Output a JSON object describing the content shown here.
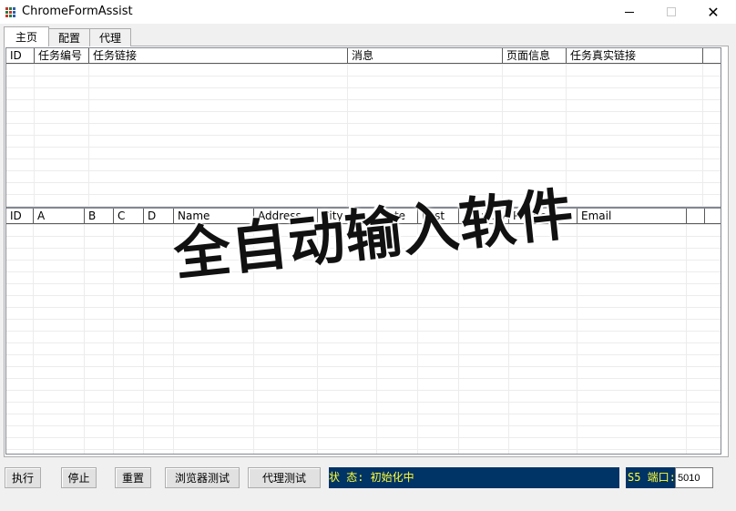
{
  "window": {
    "title": "ChromeFormAssist",
    "close_glyph": "✕"
  },
  "tabs": [
    {
      "label": "主页"
    },
    {
      "label": "配置"
    },
    {
      "label": "代理"
    }
  ],
  "task_grid": {
    "columns": [
      "ID",
      "任务编号",
      "任务链接",
      "消息",
      "页面信息",
      "任务真实链接"
    ]
  },
  "data_grid": {
    "columns": [
      "ID",
      "A",
      "B",
      "C",
      "D",
      "Name",
      "Address",
      "City",
      "Sate",
      "Post",
      "Country",
      "Phone",
      "Email"
    ]
  },
  "watermark": "全自动输入软件",
  "toolbar": {
    "execute_label": "执行",
    "stop_label": "停止",
    "reset_label": "重置",
    "browser_test_label": "浏览器测试",
    "proxy_test_label": "代理测试"
  },
  "status": {
    "text": "状 态: 初始化中",
    "port_label": "S5 端口:",
    "port_value": "5010"
  },
  "colors": {
    "status_bg": "#003366",
    "status_text": "#ffff33"
  }
}
